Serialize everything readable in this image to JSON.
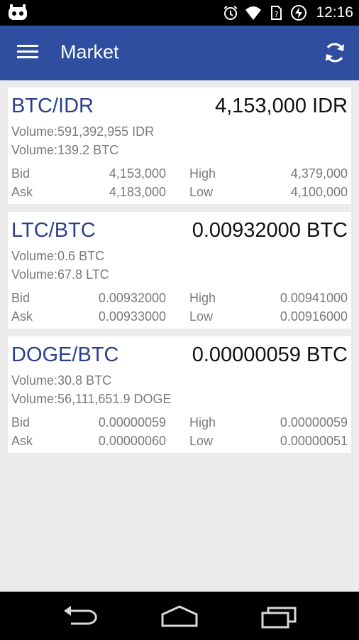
{
  "status_bar": {
    "time": "12:16",
    "icons": [
      "cyanogen-icon",
      "alarm-icon",
      "wifi-icon",
      "no-sim-icon",
      "battery-charging-icon"
    ]
  },
  "app_bar": {
    "title": "Market",
    "menu_icon": "hamburger-menu-icon",
    "refresh_icon": "refresh-icon",
    "color": "#2f4ea0"
  },
  "markets": [
    {
      "pair": "BTC/IDR",
      "price": "4,153,000 IDR",
      "volume1": "Volume:591,392,955 IDR",
      "volume2": "Volume:139.2 BTC",
      "bid_label": "Bid",
      "bid": "4,153,000",
      "ask_label": "Ask",
      "ask": "4,183,000",
      "high_label": "High",
      "high": "4,379,000",
      "low_label": "Low",
      "low": "4,100,000"
    },
    {
      "pair": "LTC/BTC",
      "price": "0.00932000 BTC",
      "volume1": "Volume:0.6 BTC",
      "volume2": "Volume:67.8 LTC",
      "bid_label": "Bid",
      "bid": "0.00932000",
      "ask_label": "Ask",
      "ask": "0.00933000",
      "high_label": "High",
      "high": "0.00941000",
      "low_label": "Low",
      "low": "0.00916000"
    },
    {
      "pair": "DOGE/BTC",
      "price": "0.00000059 BTC",
      "volume1": "Volume:30.8 BTC",
      "volume2": "Volume:56,111,651.9 DOGE",
      "bid_label": "Bid",
      "bid": "0.00000059",
      "ask_label": "Ask",
      "ask": "0.00000060",
      "high_label": "High",
      "high": "0.00000059",
      "low_label": "Low",
      "low": "0.00000051"
    }
  ],
  "nav_bar": {
    "buttons": [
      "back-icon",
      "home-icon",
      "recents-icon"
    ]
  }
}
